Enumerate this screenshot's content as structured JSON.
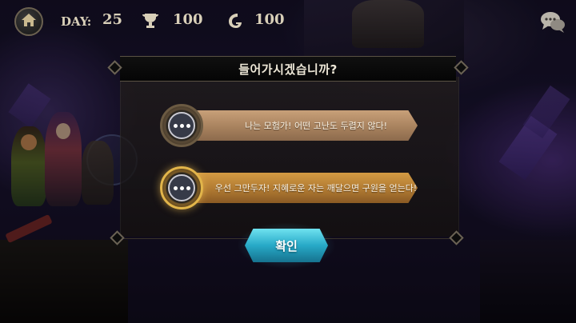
{
  "hud": {
    "home_icon": "home-icon",
    "day_label": "DAY:",
    "day_value": "25",
    "stat1_icon": "trophy-icon",
    "stat1_value": "100",
    "stat2_icon": "gold-coin-icon",
    "stat2_value": "100",
    "chat_icon": "chat-bubbles-icon"
  },
  "dialog": {
    "title": "들어가시겠습니까?",
    "options": [
      {
        "label": "나는 모험가! 어떤 고난도 두렵지 않다!",
        "icon": "ellipsis-icon",
        "selected": false
      },
      {
        "label": "우선 그만두자! 지혜로운 자는 깨달으면 구원을 얻는다!",
        "icon": "ellipsis-icon",
        "selected": true
      }
    ],
    "confirm_label": "확인"
  },
  "colors": {
    "accent_gold": "#e2b54a",
    "confirm_cyan": "#27a9c7",
    "banner_tan": "#b08a66",
    "banner_gold": "#b07a32"
  }
}
